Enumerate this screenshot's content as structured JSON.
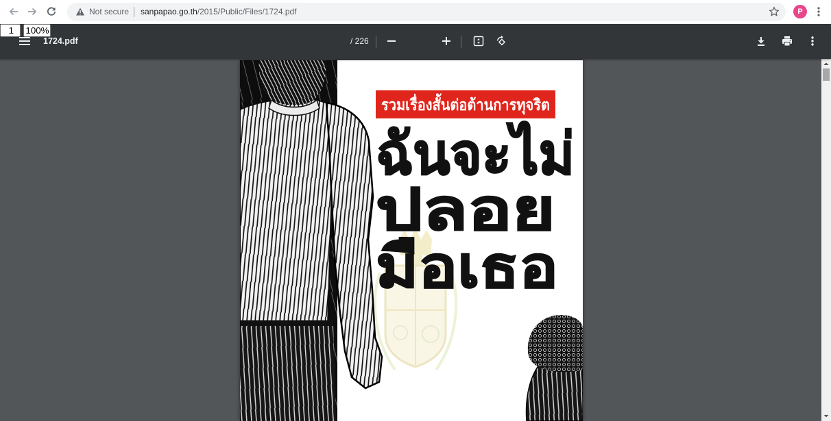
{
  "browser": {
    "back_icon": "arrow-left-icon",
    "forward_icon": "arrow-right-icon",
    "reload_icon": "reload-icon",
    "address": {
      "security_icon": "warning-triangle-icon",
      "security_label": "Not secure",
      "domain": "sanpapao.go.th",
      "path": "/2015/Public/Files/1724.pdf"
    },
    "bookmark_icon": "star-icon",
    "profile": {
      "initial": "P",
      "color": "#e8468a"
    },
    "menu_icon": "kebab-menu-icon"
  },
  "pdf_toolbar": {
    "menu_icon": "hamburger-icon",
    "title": "1724.pdf",
    "page": {
      "current": "1",
      "total_label": "/ 226"
    },
    "zoom": {
      "out_icon": "minus-icon",
      "value": "100%",
      "in_icon": "plus-icon"
    },
    "fit_icon": "fit-to-page-icon",
    "rotate_icon": "rotate-counterclockwise-icon",
    "download_icon": "download-icon",
    "print_icon": "print-icon",
    "more_icon": "kebab-menu-icon"
  },
  "document": {
    "banner": "รวมเรื่องสั้นต่อต้านการทุจริต",
    "title_lines": [
      "ฉันจะไม่",
      "ปลอย",
      "มือเธอ"
    ],
    "banner_color": "#e0261c"
  },
  "scrollbar": {
    "position": 0
  },
  "theme": {
    "chrome_bg": "#ffffff",
    "omnibox_bg": "#f1f3f4",
    "toolbar_bg": "#323639",
    "viewer_bg": "#525659"
  }
}
